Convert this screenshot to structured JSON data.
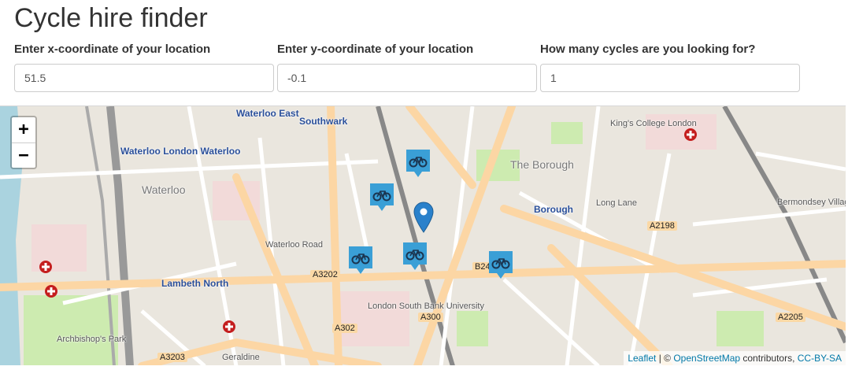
{
  "page": {
    "title": "Cycle hire finder"
  },
  "form": {
    "x_label": "Enter x-coordinate of your location",
    "x_value": "51.5",
    "y_label": "Enter y-coordinate of your location",
    "y_value": "-0.1",
    "n_label": "How many cycles are you looking for?",
    "n_value": "1"
  },
  "map": {
    "zoom_in": "+",
    "zoom_out": "−",
    "attribution": {
      "leaflet": "Leaflet",
      "sep": " | © ",
      "osm": "OpenStreetMap",
      "contributors": " contributors, ",
      "license": "CC-BY-SA"
    },
    "labels": {
      "waterloo_east": "Waterloo East",
      "southwark": "Southwark",
      "waterloo_london": "Waterloo London Waterloo",
      "waterloo": "Waterloo",
      "the_borough": "The Borough",
      "borough": "Borough",
      "kings_college": "King's College London",
      "bermondsey": "Bermondsey Village",
      "lambeth_north": "Lambeth North",
      "london_south_bank": "London South Bank University",
      "archbishops_park": "Archbishop's Park",
      "geraldine": "Geraldine",
      "long_lane": "Long Lane",
      "waterloo_road": "Waterloo Road",
      "a3202": "A3202",
      "a2198": "A2198",
      "a302": "A302",
      "a300": "A300",
      "a3203": "A3203",
      "a2205": "A2205",
      "b24": "B24"
    },
    "icons": {
      "cycle": "bicycle-marker-icon",
      "location": "location-pin-icon",
      "hospital": "hospital-icon"
    }
  }
}
